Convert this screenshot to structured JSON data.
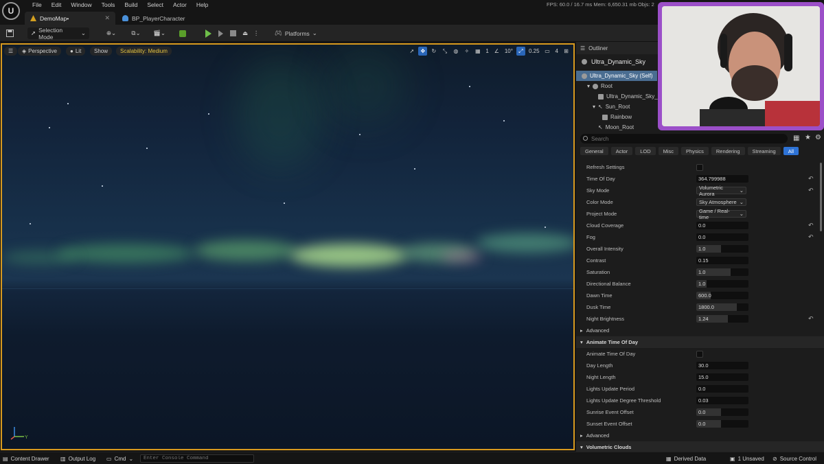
{
  "menu": [
    "File",
    "Edit",
    "Window",
    "Tools",
    "Build",
    "Select",
    "Actor",
    "Help"
  ],
  "stats": "FPS: 60.0  /  16.7 ms   Mem: 6,650.31 mb   Objs: 2",
  "tabs": [
    {
      "label": "DemoMap•",
      "active": true
    },
    {
      "label": "BP_PlayerCharacter",
      "active": false
    }
  ],
  "toolbar": {
    "selection_mode": "Selection Mode",
    "platforms": "Platforms"
  },
  "viewport": {
    "perspective": "Perspective",
    "lit": "Lit",
    "show": "Show",
    "scalability": "Scalability: Medium",
    "grid_num": "1",
    "angle": "10°",
    "scale": "0.25",
    "camera_speed": "4"
  },
  "outliner": {
    "title": "Outliner",
    "actor": "Ultra_Dynamic_Sky",
    "tree": [
      {
        "label": "Ultra_Dynamic_Sky (Self)",
        "indent": 0,
        "selected": true
      },
      {
        "label": "Root",
        "indent": 1,
        "selected": false
      },
      {
        "label": "Ultra_Dynamic_Sky_",
        "indent": 2,
        "selected": false
      },
      {
        "label": "Sun_Root",
        "indent": 2,
        "selected": false
      },
      {
        "label": "Rainbow",
        "indent": 3,
        "selected": false
      },
      {
        "label": "Moon_Root",
        "indent": 2,
        "selected": false
      }
    ]
  },
  "details": {
    "search_placeholder": "Search",
    "categories": [
      "General",
      "Actor",
      "LOD",
      "Misc",
      "Physics",
      "Rendering",
      "Streaming",
      "All"
    ],
    "active_category": "All",
    "properties": [
      {
        "label": "Refresh Settings",
        "kind": "check",
        "value": "",
        "fill": 0,
        "reset": false
      },
      {
        "label": "Time Of Day",
        "kind": "field",
        "value": "364.799988",
        "fill": 0,
        "reset": true
      },
      {
        "label": "Sky Mode",
        "kind": "drop",
        "value": "Volumetric Aurora",
        "fill": 0,
        "reset": true
      },
      {
        "label": "Color Mode",
        "kind": "drop",
        "value": "Sky Atmosphere",
        "fill": 0,
        "reset": false
      },
      {
        "label": "Project Mode",
        "kind": "drop",
        "value": "Game / Real-time",
        "fill": 0,
        "reset": false
      },
      {
        "label": "Cloud Coverage",
        "kind": "field",
        "value": "0.0",
        "fill": 0,
        "reset": true
      },
      {
        "label": "Fog",
        "kind": "field",
        "value": "0.0",
        "fill": 0,
        "reset": true
      },
      {
        "label": "Overall Intensity",
        "kind": "field",
        "value": "1.0",
        "fill": 0.48,
        "reset": false
      },
      {
        "label": "Contrast",
        "kind": "field",
        "value": "0.15",
        "fill": 0,
        "reset": false
      },
      {
        "label": "Saturation",
        "kind": "field",
        "value": "1.0",
        "fill": 0.66,
        "reset": false
      },
      {
        "label": "Directional Balance",
        "kind": "field",
        "value": "1.0",
        "fill": 0.2,
        "reset": false
      },
      {
        "label": "Dawn Time",
        "kind": "field",
        "value": "600.0",
        "fill": 0.28,
        "reset": false
      },
      {
        "label": "Dusk Time",
        "kind": "field",
        "value": "1800.0",
        "fill": 0.78,
        "reset": false
      },
      {
        "label": "Night Brightness",
        "kind": "field",
        "value": "1.24",
        "fill": 0.6,
        "reset": true
      }
    ],
    "section_advanced_1": "Advanced",
    "section_animate": "Animate Time Of Day",
    "animate_properties": [
      {
        "label": "Animate Time Of Day",
        "kind": "check",
        "value": "",
        "fill": 0
      },
      {
        "label": "Day Length",
        "kind": "field",
        "value": "30.0",
        "fill": 0
      },
      {
        "label": "Night Length",
        "kind": "field",
        "value": "15.0",
        "fill": 0
      },
      {
        "label": "Lights Update Period",
        "kind": "field",
        "value": "0.0",
        "fill": 0
      },
      {
        "label": "Lights Update Degree Threshold",
        "kind": "field",
        "value": "0.03",
        "fill": 0
      },
      {
        "label": "Sunrise Event Offset",
        "kind": "field",
        "value": "0.0",
        "fill": 0.48
      },
      {
        "label": "Sunset Event Offset",
        "kind": "field",
        "value": "0.0",
        "fill": 0.48
      }
    ],
    "section_advanced_2": "Advanced",
    "section_clouds": "Volumetric Clouds"
  },
  "statusbar": {
    "content_drawer": "Content Drawer",
    "output_log": "Output Log",
    "cmd": "Cmd",
    "console_placeholder": "Enter Console Command",
    "derived_data": "Derived Data",
    "unsaved": "1 Unsaved",
    "source_control": "Source Control"
  }
}
